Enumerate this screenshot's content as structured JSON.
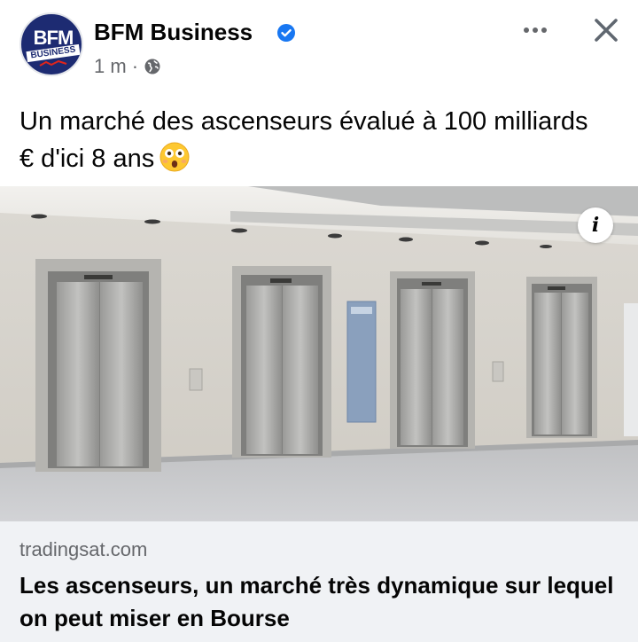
{
  "post": {
    "page_name": "BFM Business",
    "avatar_logo_top": "BFM",
    "avatar_logo_bottom": "BUSINESS",
    "timestamp": "1 m",
    "separator": "·",
    "visibility_icon": "globe-icon",
    "verified_icon": "verified-badge-icon",
    "verified_color": "#1877f2",
    "text": "Un marché des ascenseurs évalué à 100 milliards € d'ici 8 ans",
    "emoji": "astonished-face-emoji"
  },
  "header_actions": {
    "more_icon": "more-options-icon",
    "close_icon": "close-icon"
  },
  "image": {
    "description_icon": "info-icon",
    "info_label": "i"
  },
  "link_preview": {
    "domain": "tradingsat.com",
    "title": "Les ascenseurs, un marché très dynamique sur lequel on peut miser en Bourse"
  },
  "colors": {
    "accent": "#1877f2",
    "secondary_text": "#65676b",
    "preview_bg": "#f0f2f5",
    "brand_navy": "#1d2b72"
  }
}
